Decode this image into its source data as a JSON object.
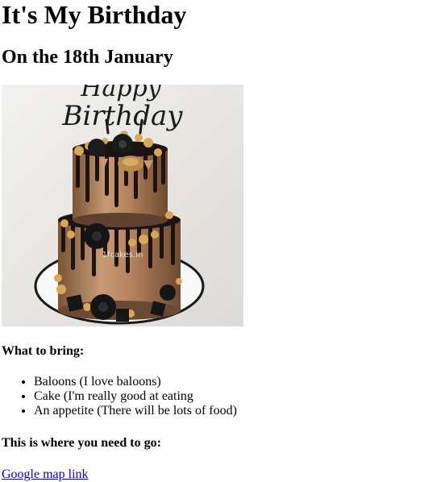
{
  "header": {
    "title": "It's My Birthday",
    "subtitle": "On the 18th January"
  },
  "photo": {
    "topper_text_line1": "Happy",
    "topper_text_line2": "Birthday",
    "watermark": "1fcakes.in"
  },
  "bring": {
    "heading": "What to bring:",
    "items": [
      "Baloons (I love baloons)",
      "Cake (I'm really good at eating",
      "An appetite (There will be lots of food)"
    ]
  },
  "directions": {
    "heading": "This is where you need to go:",
    "link_text": "Google map link"
  }
}
